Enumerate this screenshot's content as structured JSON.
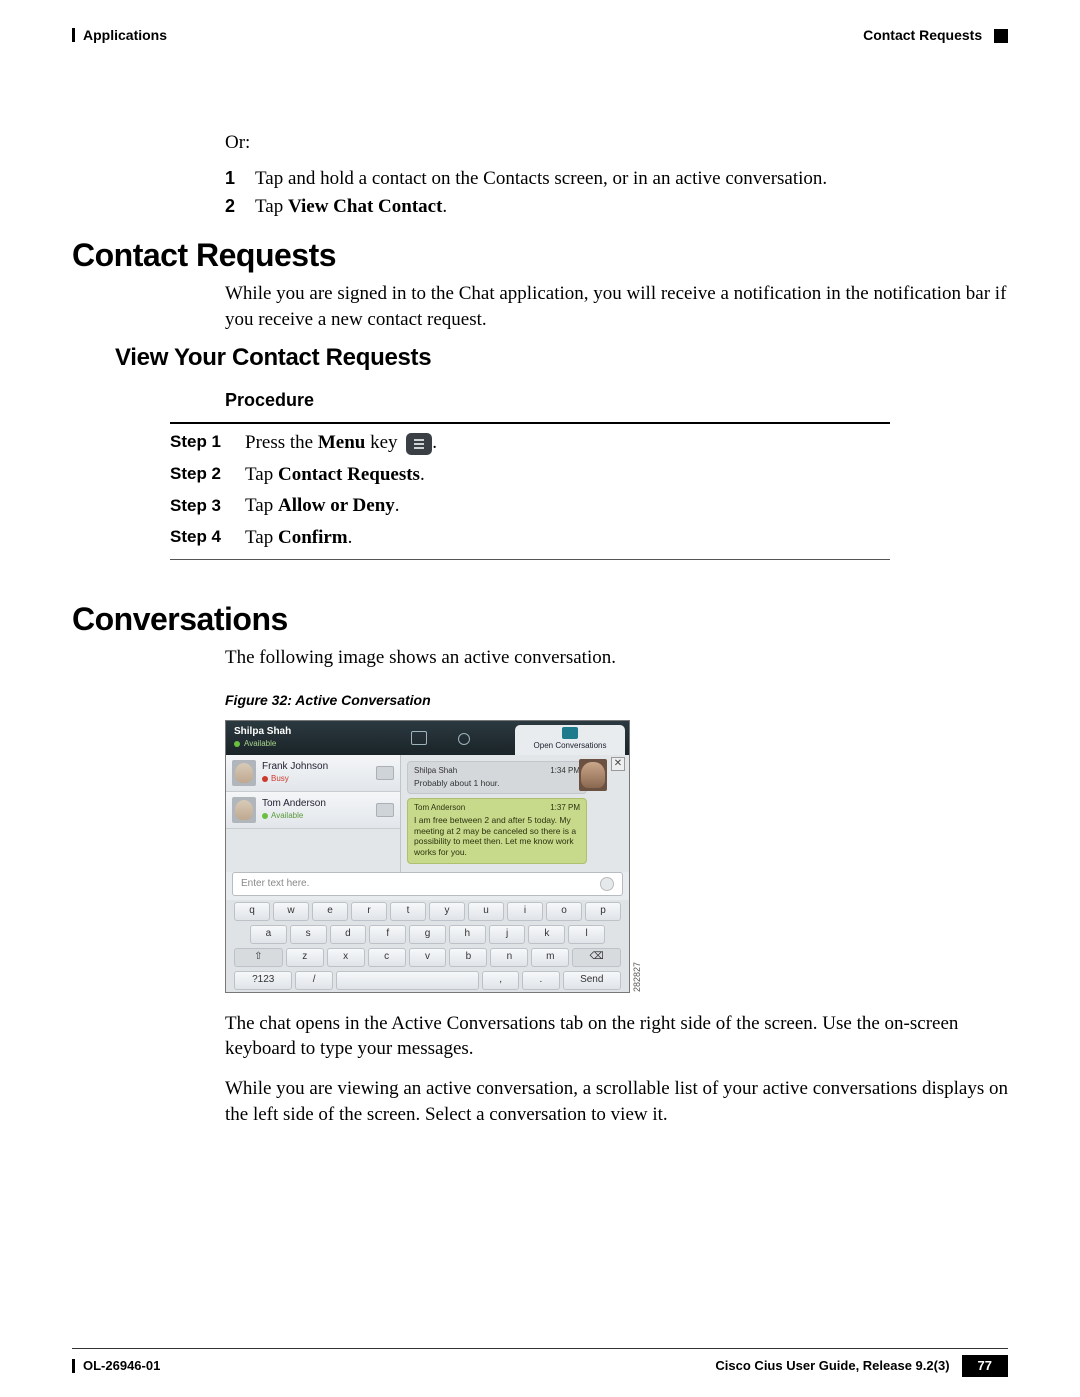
{
  "header": {
    "left": "Applications",
    "right": "Contact Requests"
  },
  "intro": {
    "or": "Or:",
    "step1_num": "1",
    "step1_text": "Tap and hold a contact on the Contacts screen, or in an active conversation.",
    "step2_num": "2",
    "step2_pre": "Tap ",
    "step2_bold": "View Chat Contact",
    "step2_post": "."
  },
  "sec1": {
    "h1": "Contact Requests",
    "para": "While you are signed in to the Chat application, you will receive a notification in the notification bar if you receive a new contact request.",
    "h2": "View Your Contact Requests",
    "procedure": "Procedure",
    "steps": [
      {
        "label": "Step 1",
        "pre": "Press the ",
        "bold": "Menu",
        "post": " key ",
        "icon": true,
        "tail": "."
      },
      {
        "label": "Step 2",
        "pre": "Tap ",
        "bold": "Contact Requests",
        "post": "."
      },
      {
        "label": "Step 3",
        "pre": "Tap ",
        "bold": "Allow or Deny",
        "post": "."
      },
      {
        "label": "Step 4",
        "pre": "Tap ",
        "bold": "Confirm",
        "post": "."
      }
    ]
  },
  "sec2": {
    "h1": "Conversations",
    "para1": "The following image shows an active conversation.",
    "fig_caption": "Figure 32: Active Conversation",
    "para2": "The chat opens in the Active Conversations tab on the right side of the screen. Use the on-screen keyboard to type your messages.",
    "para3": "While you are viewing an active conversation, a scrollable list of your active conversations displays on the left side of the screen. Select a conversation to view it."
  },
  "figure": {
    "user": {
      "name": "Shilpa Shah",
      "status": "Available"
    },
    "tab": "Open Conversations",
    "contacts": [
      {
        "name": "Frank Johnson",
        "status": "Busy",
        "kind": "busy"
      },
      {
        "name": "Tom Anderson",
        "status": "Available",
        "kind": "avail"
      }
    ],
    "messages": [
      {
        "from": "Shilpa Shah",
        "time": "1:34 PM",
        "text": "Probably about 1 hour.",
        "cls": "grey"
      },
      {
        "from": "Tom Anderson",
        "time": "1:37 PM",
        "text": "I am free between 2 and after 5 today. My meeting at 2 may be canceled so there is a possibility to meet then. Let me know work works for you.",
        "cls": "green"
      }
    ],
    "close": "✕",
    "input_placeholder": "Enter text here.",
    "keyboard": {
      "row1": [
        "q",
        "w",
        "e",
        "r",
        "t",
        "y",
        "u",
        "i",
        "o",
        "p"
      ],
      "row2": [
        "a",
        "s",
        "d",
        "f",
        "g",
        "h",
        "j",
        "k",
        "l"
      ],
      "row3_shift": "⇧",
      "row3": [
        "z",
        "x",
        "c",
        "v",
        "b",
        "n",
        "m"
      ],
      "row3_bksp": "⌫",
      "row4_sym": "?123",
      "row4_slash": "/",
      "row4_space": "",
      "row4_comma": ",",
      "row4_period": ".",
      "row4_send": "Send"
    },
    "image_id": "282827"
  },
  "footer": {
    "left": "OL-26946-01",
    "right": "Cisco Cius User Guide, Release 9.2(3)",
    "page": "77"
  }
}
